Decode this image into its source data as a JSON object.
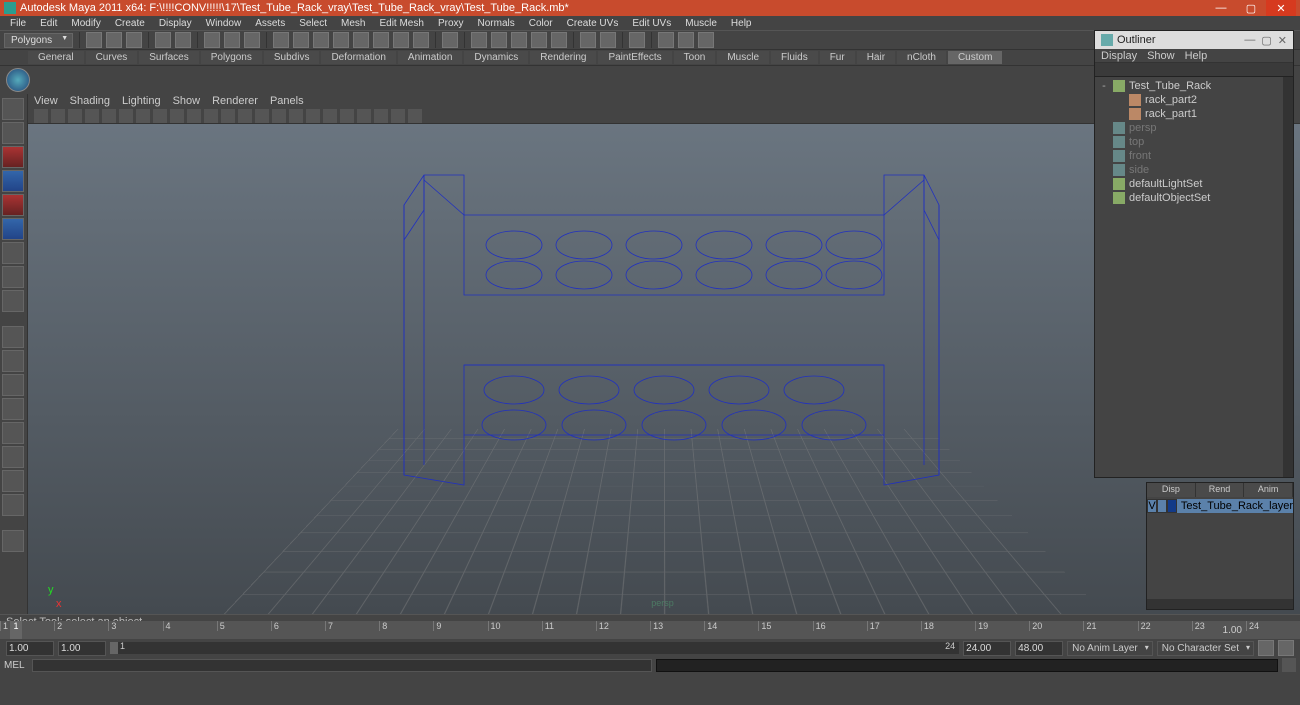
{
  "title": "Autodesk Maya 2011 x64: F:\\!!!!CONV!!!!!\\17\\Test_Tube_Rack_vray\\Test_Tube_Rack_vray\\Test_Tube_Rack.mb*",
  "menus": [
    "File",
    "Edit",
    "Modify",
    "Create",
    "Display",
    "Window",
    "Assets",
    "Select",
    "Mesh",
    "Edit Mesh",
    "Proxy",
    "Normals",
    "Color",
    "Create UVs",
    "Edit UVs",
    "Muscle",
    "Help"
  ],
  "mode_dropdown": "Polygons",
  "shelf_tabs": [
    "General",
    "Curves",
    "Surfaces",
    "Polygons",
    "Subdivs",
    "Deformation",
    "Animation",
    "Dynamics",
    "Rendering",
    "PaintEffects",
    "Toon",
    "Muscle",
    "Fluids",
    "Fur",
    "Hair",
    "nCloth",
    "Custom"
  ],
  "shelf_active": "Custom",
  "viewport_menus": [
    "View",
    "Shading",
    "Lighting",
    "Show",
    "Renderer",
    "Panels"
  ],
  "persp_label": "persp",
  "outliner": {
    "title": "Outliner",
    "menus": [
      "Display",
      "Show",
      "Help"
    ],
    "items": [
      {
        "label": "Test_Tube_Rack",
        "type": "grp",
        "indent": 0,
        "dim": false,
        "exp": "-"
      },
      {
        "label": "rack_part2",
        "type": "mesh",
        "indent": 1,
        "dim": false,
        "exp": ""
      },
      {
        "label": "rack_part1",
        "type": "mesh",
        "indent": 1,
        "dim": false,
        "exp": ""
      },
      {
        "label": "persp",
        "type": "cam",
        "indent": 0,
        "dim": true,
        "exp": ""
      },
      {
        "label": "top",
        "type": "cam",
        "indent": 0,
        "dim": true,
        "exp": ""
      },
      {
        "label": "front",
        "type": "cam",
        "indent": 0,
        "dim": true,
        "exp": ""
      },
      {
        "label": "side",
        "type": "cam",
        "indent": 0,
        "dim": true,
        "exp": ""
      },
      {
        "label": "defaultLightSet",
        "type": "grp",
        "indent": 0,
        "dim": false,
        "exp": ""
      },
      {
        "label": "defaultObjectSet",
        "type": "grp",
        "indent": 0,
        "dim": false,
        "exp": ""
      }
    ]
  },
  "layer": {
    "name": "Test_Tube_Rack_layer",
    "vis": "V"
  },
  "timeline": {
    "ticks": [
      "1",
      "2",
      "3",
      "4",
      "5",
      "6",
      "7",
      "8",
      "9",
      "10",
      "11",
      "12",
      "13",
      "14",
      "15",
      "16",
      "17",
      "18",
      "19",
      "20",
      "21",
      "22",
      "23",
      "24"
    ],
    "current": "1",
    "end": "1.00",
    "range_start_outer": "1.00",
    "range_start_inner": "1.00",
    "range_slider_label": "1",
    "range_end_inner": "24",
    "range_end_a": "24.00",
    "range_end_b": "48.00",
    "anim_layer": "No Anim Layer",
    "char_set": "No Character Set"
  },
  "cmd_label": "MEL",
  "helpline": "Select Tool: select an object"
}
